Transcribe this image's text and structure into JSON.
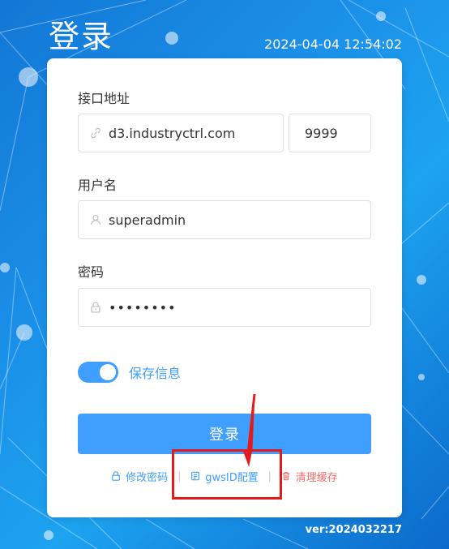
{
  "page": {
    "title": "登录",
    "datetime": "2024-04-04 12:54:02",
    "version": "ver:2024032217"
  },
  "form": {
    "api_label": "接口地址",
    "api_host": "d3.industryctrl.com",
    "api_port": "9999",
    "username_label": "用户名",
    "username_value": "superadmin",
    "password_label": "密码",
    "password_value": "••••••••",
    "remember_label": "保存信息",
    "remember_checked": true,
    "login_button": "登录"
  },
  "links": {
    "change_password": "修改密码",
    "gws_config": "gwsID配置",
    "clear_cache": "清理缓存",
    "separator": "|"
  },
  "icons": {
    "host": "link-icon",
    "user": "user-icon",
    "password": "lock-icon",
    "change_password": "lock-icon",
    "gws_config": "document-icon",
    "clear_cache": "trash-icon"
  },
  "colors": {
    "accent": "#409eff",
    "danger": "#f56c6c",
    "annotation": "#e31b1b"
  }
}
